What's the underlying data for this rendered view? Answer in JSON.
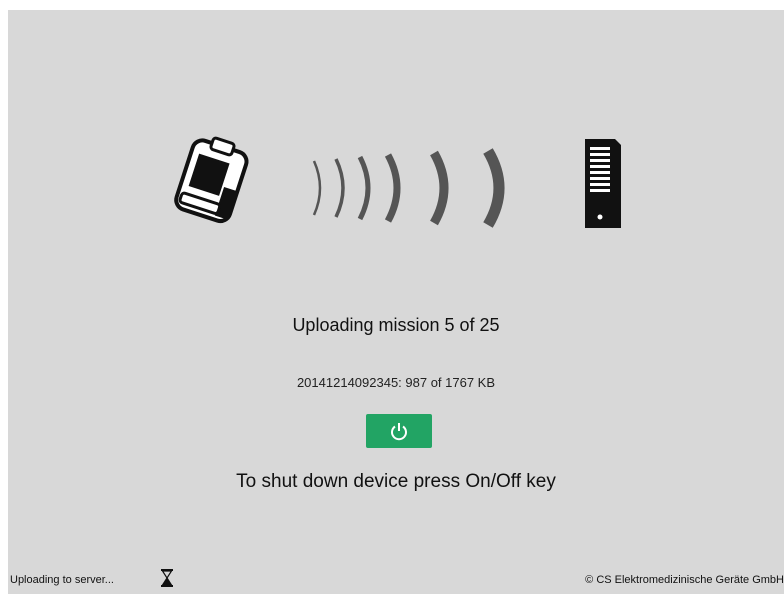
{
  "main": {
    "mission_status": "Uploading mission 5 of 25",
    "file_progress": "20141214092345: 987 of 1767 KB",
    "shutdown_hint": "To shut down device press On/Off key"
  },
  "icons": {
    "device": "defibrillator-icon",
    "transfer": "transmission-waves-icon",
    "server": "server-icon",
    "power": "power-icon",
    "busy": "hourglass-icon"
  },
  "status_bar": {
    "label": "Uploading to server...",
    "copyright": "© CS Elektromedizinische Geräte GmbH"
  },
  "colors": {
    "background": "#d8d8d8",
    "power_button": "#22a464",
    "icon_dark": "#111111",
    "wave_gray": "#555555"
  }
}
